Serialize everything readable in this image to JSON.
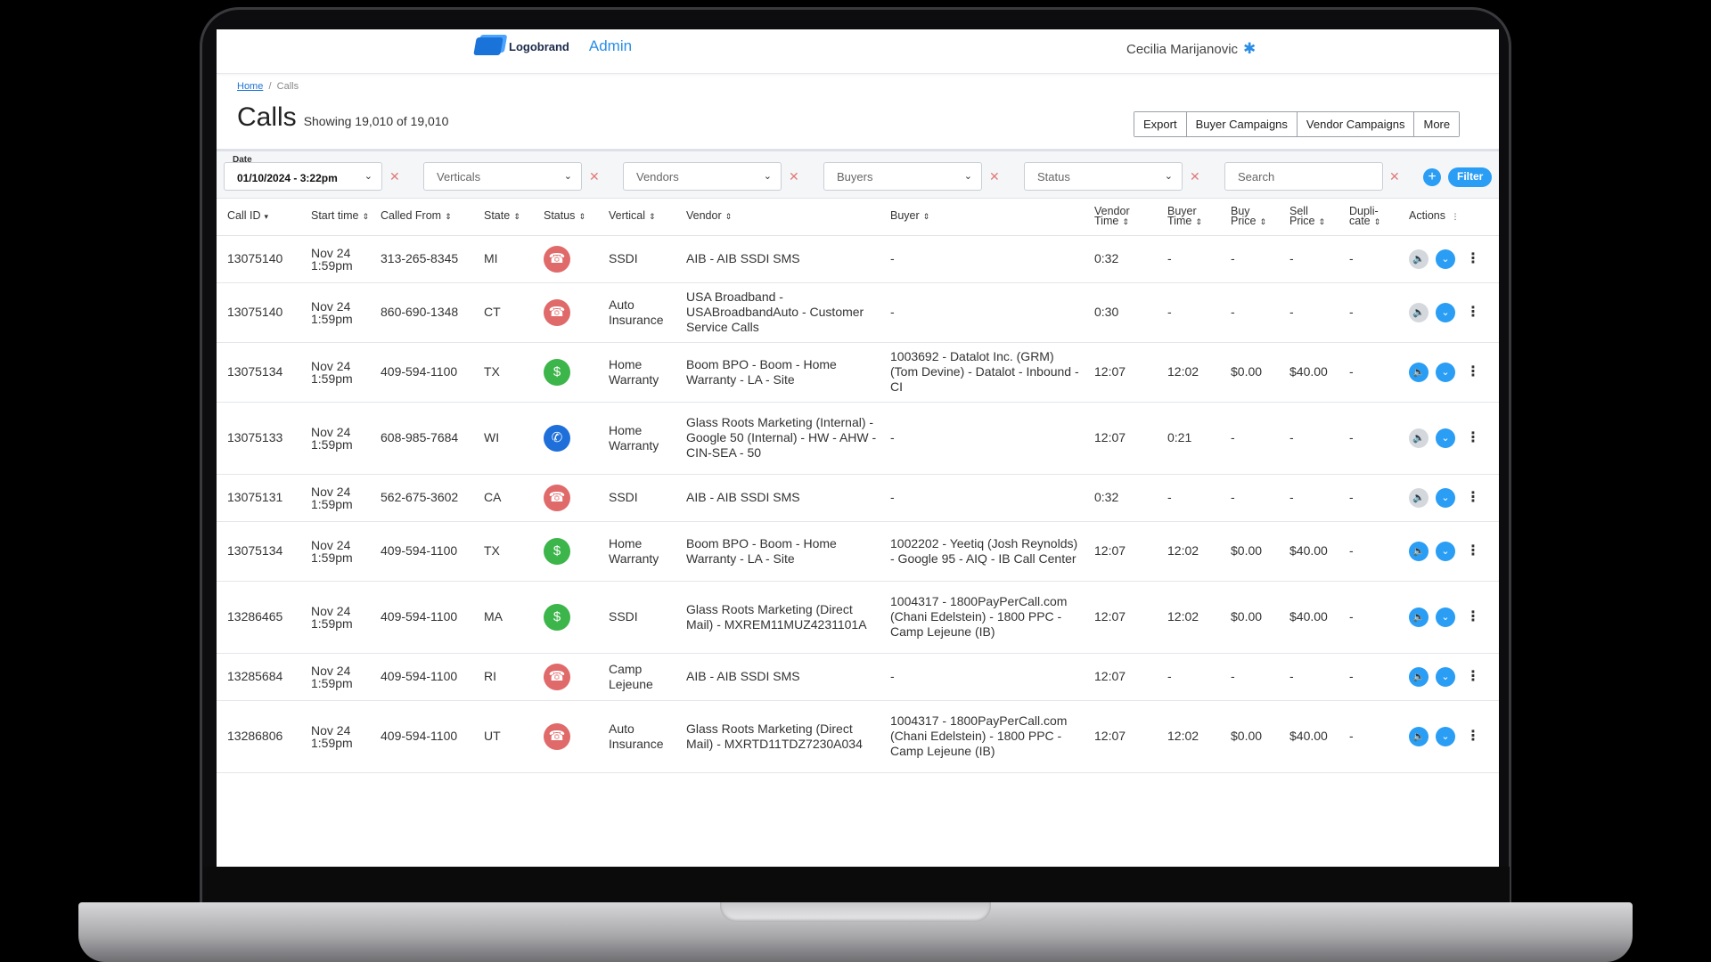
{
  "header": {
    "logo_text": "Logobrand",
    "app_name": "Admin",
    "user_name": "Cecilia Marijanovic"
  },
  "breadcrumb": {
    "home": "Home",
    "current": "Calls"
  },
  "page": {
    "title": "Calls",
    "subtitle": "Showing 19,010 of 19,010"
  },
  "actions": {
    "export": "Export",
    "buyer_campaigns": "Buyer Campaigns",
    "vendor_campaigns": "Vendor Campaigns",
    "more": "More"
  },
  "filters": {
    "date_label": "Date",
    "date_value": "01/10/2024 - 3:22pm",
    "verticals": "Verticals",
    "vendors": "Vendors",
    "buyers": "Buyers",
    "status": "Status",
    "search_placeholder": "Search",
    "filter_button": "Filter"
  },
  "columns": [
    "Call ID",
    "Start time",
    "Called From",
    "State",
    "Status",
    "Vertical",
    "Vendor",
    "Buyer",
    "Vendor Time",
    "Buyer Time",
    "Buy Price",
    "Sell Price",
    "Dupli- cate",
    "Actions"
  ],
  "rows": [
    {
      "id": "13075140",
      "date": "Nov 24",
      "time": "1:59pm",
      "from": "313-265-8345",
      "state": "MI",
      "status": "red",
      "vertical": "SSDI",
      "vendor": "AIB - AIB SSDI SMS",
      "buyer": "-",
      "vtime": "0:32",
      "btime": "-",
      "buy": "-",
      "sell": "-",
      "dup": "-",
      "play": "grey",
      "h": 53
    },
    {
      "id": "13075140",
      "date": "Nov 24",
      "time": "1:59pm",
      "from": "860-690-1348",
      "state": "CT",
      "status": "red",
      "vertical": "Auto Insurance",
      "vendor": "USA Broadband - USABroadbandAuto - Customer Service Calls",
      "buyer": "-",
      "vtime": "0:30",
      "btime": "-",
      "buy": "-",
      "sell": "-",
      "dup": "-",
      "play": "grey",
      "h": 67
    },
    {
      "id": "13075134",
      "date": "Nov 24",
      "time": "1:59pm",
      "from": "409-594-1100",
      "state": "TX",
      "status": "green",
      "vertical": "Home Warranty",
      "vendor": "Boom BPO - Boom - Home Warranty - LA - Site",
      "buyer": "1003692 - Datalot Inc. (GRM) (Tom Devine) - Datalot - Inbound - CI",
      "vtime": "12:07",
      "btime": "12:02",
      "buy": "$0.00",
      "sell": "$40.00",
      "dup": "-",
      "play": "blue",
      "h": 67
    },
    {
      "id": "13075133",
      "date": "Nov 24",
      "time": "1:59pm",
      "from": "608-985-7684",
      "state": "WI",
      "status": "blue",
      "vertical": "Home Warranty",
      "vendor": "Glass Roots Marketing (Internal) - Google 50 (Internal) - HW - AHW - CIN-SEA - 50",
      "buyer": "-",
      "vtime": "12:07",
      "btime": "0:21",
      "buy": "-",
      "sell": "-",
      "dup": "-",
      "play": "grey",
      "h": 81
    },
    {
      "id": "13075131",
      "date": "Nov 24",
      "time": "1:59pm",
      "from": "562-675-3602",
      "state": "CA",
      "status": "red",
      "vertical": "SSDI",
      "vendor": "AIB - AIB SSDI SMS",
      "buyer": "-",
      "vtime": "0:32",
      "btime": "-",
      "buy": "-",
      "sell": "-",
      "dup": "-",
      "play": "grey",
      "h": 53
    },
    {
      "id": "13075134",
      "date": "Nov 24",
      "time": "1:59pm",
      "from": "409-594-1100",
      "state": "TX",
      "status": "green",
      "vertical": "Home Warranty",
      "vendor": "Boom BPO - Boom - Home Warranty - LA - Site",
      "buyer": "1002202 - Yeetiq (Josh Reynolds) - Google 95 - AIQ - IB Call Center",
      "vtime": "12:07",
      "btime": "12:02",
      "buy": "$0.00",
      "sell": "$40.00",
      "dup": "-",
      "play": "blue",
      "h": 67
    },
    {
      "id": "13286465",
      "date": "Nov 24",
      "time": "1:59pm",
      "from": "409-594-1100",
      "state": "MA",
      "status": "green",
      "vertical": "SSDI",
      "vendor": "Glass Roots Marketing (Direct Mail) - MXREM11MUZ4231101A",
      "buyer": "1004317 - 1800PayPerCall.com (Chani Edelstein) - 1800 PPC - Camp Lejeune (IB)",
      "vtime": "12:07",
      "btime": "12:02",
      "buy": "$0.00",
      "sell": "$40.00",
      "dup": "-",
      "play": "blue",
      "h": 81
    },
    {
      "id": "13285684",
      "date": "Nov 24",
      "time": "1:59pm",
      "from": "409-594-1100",
      "state": "RI",
      "status": "red",
      "vertical": "Camp Lejeune",
      "vendor": "AIB - AIB SSDI SMS",
      "buyer": "-",
      "vtime": "12:07",
      "btime": "-",
      "buy": "-",
      "sell": "-",
      "dup": "-",
      "play": "blue",
      "h": 53
    },
    {
      "id": "13286806",
      "date": "Nov 24",
      "time": "1:59pm",
      "from": "409-594-1100",
      "state": "UT",
      "status": "red",
      "vertical": "Auto Insurance",
      "vendor": "Glass Roots Marketing (Direct Mail) - MXRTD11TDZ7230A034",
      "buyer": "1004317 - 1800PayPerCall.com (Chani Edelstein) - 1800 PPC - Camp Lejeune (IB)",
      "vtime": "12:07",
      "btime": "12:02",
      "buy": "$0.00",
      "sell": "$40.00",
      "dup": "-",
      "play": "blue",
      "h": 81
    }
  ],
  "colors": {
    "accent": "#2a9df4",
    "status_red": "#e06a6a",
    "status_green": "#3cb54a",
    "status_blue": "#1e6fd9"
  }
}
